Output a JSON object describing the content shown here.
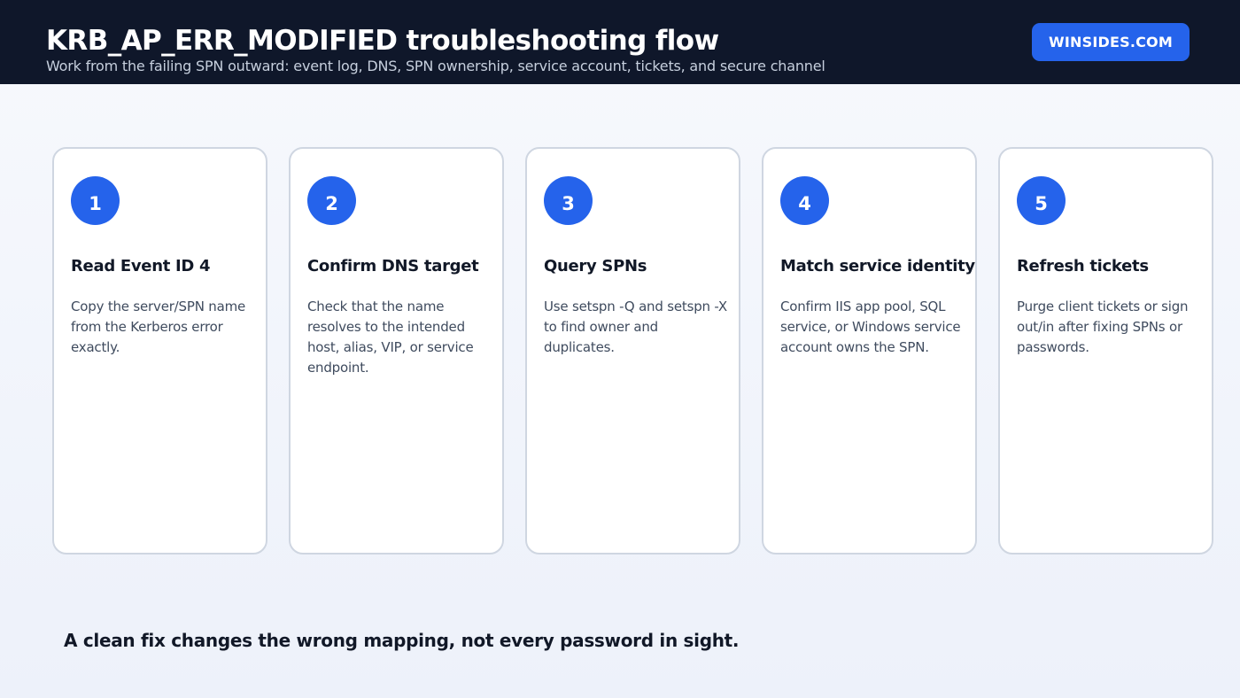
{
  "header": {
    "title": "KRB_AP_ERR_MODIFIED troubleshooting flow",
    "subtitle": "Work from the failing SPN outward: event log, DNS, SPN ownership, service account, tickets, and secure channel",
    "brand": "WINSIDES.COM"
  },
  "colors": {
    "header_bg": "#0f172a",
    "accent": "#2563eb",
    "card_border": "#cfd6e1"
  },
  "steps": [
    {
      "number": "1",
      "title": "Read Event ID 4",
      "description": "Copy the server/SPN name from the Kerberos error exactly."
    },
    {
      "number": "2",
      "title": "Confirm DNS target",
      "description": "Check that the name resolves to the intended host, alias, VIP, or service endpoint."
    },
    {
      "number": "3",
      "title": "Query SPNs",
      "description": "Use setspn -Q and setspn -X to find owner and duplicates."
    },
    {
      "number": "4",
      "title": "Match service identity",
      "description": "Confirm IIS app pool, SQL service, or Windows service account owns the SPN."
    },
    {
      "number": "5",
      "title": "Refresh tickets",
      "description": "Purge client tickets or sign out/in after fixing SPNs or passwords."
    }
  ],
  "footer": {
    "note": "A clean fix changes the wrong mapping, not every password in sight."
  }
}
